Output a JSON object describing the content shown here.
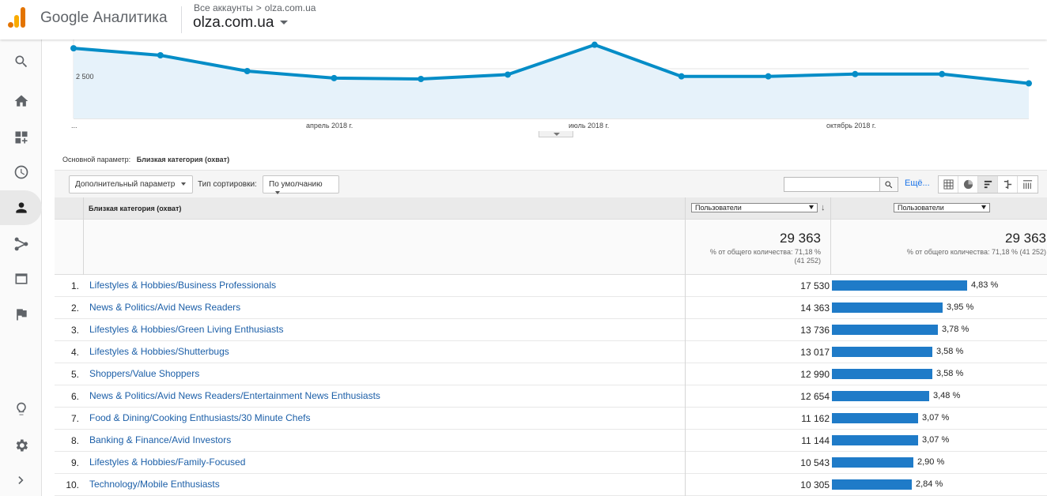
{
  "header": {
    "product": "Google Аналитика",
    "breadcrumb_all": "Все аккаунты",
    "breadcrumb_sep": ">",
    "breadcrumb_account": "olza.com.ua",
    "account_name": "olza.com.ua"
  },
  "chart_data": {
    "type": "line",
    "ytick_label": "2 500",
    "x_labels": [
      "...",
      "апрель 2018 г.",
      "июль 2018 г.",
      "октябрь 2018 г."
    ],
    "series": [
      {
        "values": [
          4000,
          3600,
          2700,
          2300,
          2250,
          2500,
          4200,
          2400,
          2400,
          2530,
          2530,
          2000
        ]
      }
    ],
    "ylim": [
      0,
      4500
    ],
    "color": "#058dc7"
  },
  "primary_dimension": {
    "label": "Основной параметр:",
    "value": "Близкая категория (охват)"
  },
  "toolbar": {
    "secondary_dim": "Дополнительный параметр",
    "sort_label": "Тип сортировки:",
    "sort_value": "По умолчанию",
    "more": "Ещё..."
  },
  "table": {
    "dim_header": "Близкая категория (охват)",
    "metric1_header": "Пользователи",
    "metric2_header": "Пользователи",
    "total": "29 363",
    "total_sub1": "% от общего количества: 71,18 %",
    "total_sub1b": "(41 252)",
    "total_sub2": "% от общего количества: 71,18 % (41 252)",
    "rows": [
      {
        "idx": "1.",
        "name": "Lifestyles & Hobbies/Business Professionals",
        "value": "17 530",
        "pct": "4,83 %",
        "frac": 4.83
      },
      {
        "idx": "2.",
        "name": "News & Politics/Avid News Readers",
        "value": "14 363",
        "pct": "3,95 %",
        "frac": 3.95
      },
      {
        "idx": "3.",
        "name": "Lifestyles & Hobbies/Green Living Enthusiasts",
        "value": "13 736",
        "pct": "3,78 %",
        "frac": 3.78
      },
      {
        "idx": "4.",
        "name": "Lifestyles & Hobbies/Shutterbugs",
        "value": "13 017",
        "pct": "3,58 %",
        "frac": 3.58
      },
      {
        "idx": "5.",
        "name": "Shoppers/Value Shoppers",
        "value": "12 990",
        "pct": "3,58 %",
        "frac": 3.58
      },
      {
        "idx": "6.",
        "name": "News & Politics/Avid News Readers/Entertainment News Enthusiasts",
        "value": "12 654",
        "pct": "3,48 %",
        "frac": 3.48
      },
      {
        "idx": "7.",
        "name": "Food & Dining/Cooking Enthusiasts/30 Minute Chefs",
        "value": "11 162",
        "pct": "3,07 %",
        "frac": 3.07
      },
      {
        "idx": "8.",
        "name": "Banking & Finance/Avid Investors",
        "value": "11 144",
        "pct": "3,07 %",
        "frac": 3.07
      },
      {
        "idx": "9.",
        "name": "Lifestyles & Hobbies/Family-Focused",
        "value": "10 543",
        "pct": "2,90 %",
        "frac": 2.9
      },
      {
        "idx": "10.",
        "name": "Technology/Mobile Enthusiasts",
        "value": "10 305",
        "pct": "2,84 %",
        "frac": 2.84
      }
    ]
  }
}
